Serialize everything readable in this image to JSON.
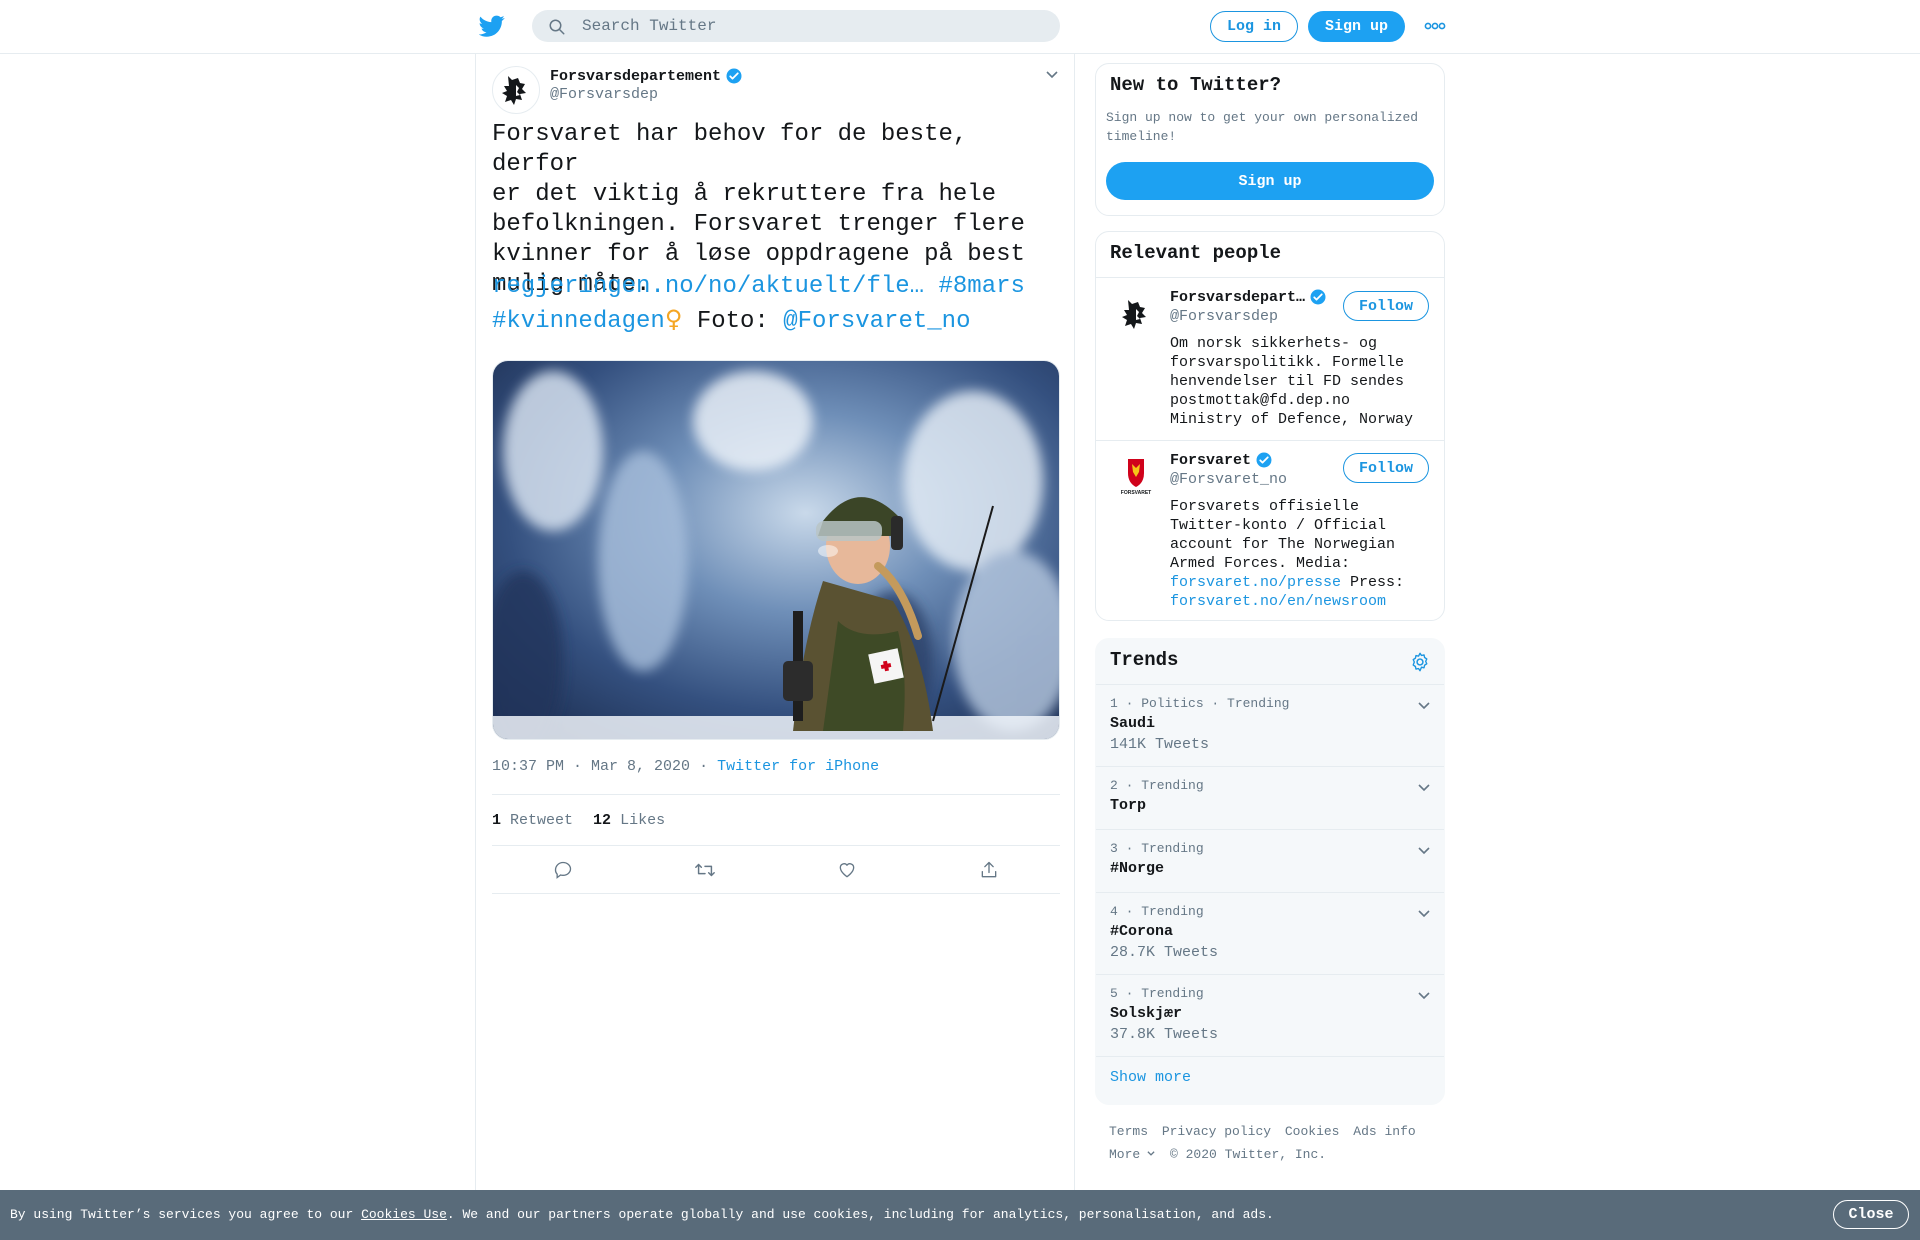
{
  "colors": {
    "accent": "#1da1f2",
    "link": "#1b95e0",
    "muted": "#657786",
    "cookie_bar": "#596b7a"
  },
  "topbar": {
    "search_placeholder": "Search Twitter",
    "login_label": "Log in",
    "signup_label": "Sign up",
    "icons": [
      "twitter-bird-icon",
      "search-icon",
      "more-icon"
    ]
  },
  "tweet": {
    "author_name": "Forsvarsdepartement",
    "author_handle": "@Forsvarsdep",
    "text_lines": [
      "Forsvaret har behov for de beste, derfor",
      "er det viktig å rekruttere fra hele",
      "befolkningen. Forsvaret trenger flere",
      "kvinner for å løse oppdragene på best",
      "mulig måte."
    ],
    "link": "regjeringen.no/no/aktuelt/fle…",
    "hashtag1": "#8mars",
    "hashtag2": "#kvinnedagen",
    "emoji": "♀",
    "foto_label": "Foto:",
    "mention": "@Forsvaret_no",
    "timestamp": "10:37 PM · Mar 8, 2020",
    "meta_separator": "·",
    "source": "Twitter for iPhone",
    "retweet_count": "1",
    "retweet_label": "Retweet",
    "likes_count": "12",
    "likes_label": "Likes"
  },
  "new_to_twitter": {
    "title": "New to Twitter?",
    "subtitle": "Sign up now to get your own personalized timeline!",
    "signup_label": "Sign up"
  },
  "relevant_people": {
    "title": "Relevant people",
    "people": [
      {
        "name": "Forsvarsdepart…",
        "handle": "@Forsvarsdep",
        "follow_label": "Follow",
        "bio_lines": [
          "Om norsk sikkerhets- og",
          "forsvarspolitikk. Formelle",
          "henvendelser til FD sendes",
          "postmottak@fd.dep.no",
          "Ministry of Defence, Norway"
        ]
      },
      {
        "name": "Forsvaret",
        "handle": "@Forsvaret_no",
        "follow_label": "Follow",
        "bio_lines": [
          "Forsvarets offisielle",
          "Twitter-konto / Official",
          "account for The Norwegian",
          "Armed Forces. Media:"
        ],
        "bio_link1": "forsvaret.no/presse",
        "bio_press": "Press:",
        "bio_link2": "forsvaret.no/en/newsroom",
        "avatar_caption": "FORSVARET"
      }
    ]
  },
  "trends": {
    "title": "Trends",
    "items": [
      {
        "meta": "1 · Politics · Trending",
        "name": "Saudi",
        "count": "141K Tweets"
      },
      {
        "meta": "2 · Trending",
        "name": "Torp",
        "count": ""
      },
      {
        "meta": "3 · Trending",
        "name": "#Norge",
        "count": ""
      },
      {
        "meta": "4 · Trending",
        "name": "#Corona",
        "count": "28.7K Tweets"
      },
      {
        "meta": "5 · Trending",
        "name": "Solskjær",
        "count": "37.8K Tweets"
      }
    ],
    "show_more": "Show more"
  },
  "footer": {
    "terms": "Terms",
    "privacy": "Privacy policy",
    "cookies": "Cookies",
    "ads": "Ads info",
    "more": "More",
    "copyright": "© 2020 Twitter, Inc."
  },
  "cookie_bar": {
    "text_before": "By using Twitter’s services you agree to our ",
    "link": "Cookies Use",
    "text_after": ". We and our partners operate globally and use cookies, including for analytics, personalisation, and ads.",
    "close_label": "Close"
  }
}
